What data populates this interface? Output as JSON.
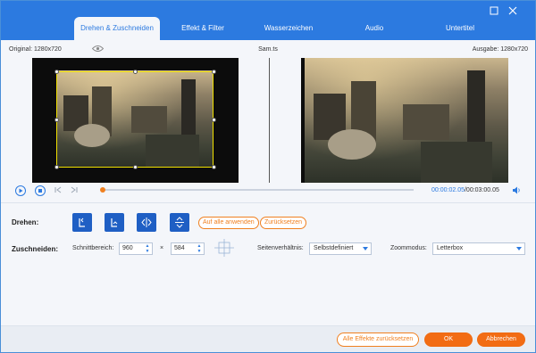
{
  "tabs": [
    {
      "label": "Drehen & Zuschneiden"
    },
    {
      "label": "Effekt & Filter"
    },
    {
      "label": "Wasserzeichen"
    },
    {
      "label": "Audio"
    },
    {
      "label": "Untertitel"
    }
  ],
  "window": {
    "restore_icon": "restore-icon",
    "close_icon": "close-icon"
  },
  "info": {
    "original": "Original: 1280x720",
    "filename": "Sam.ts",
    "output": "Ausgabe: 1280x720"
  },
  "playback": {
    "current_time": "00:00:02.05",
    "total_time": "/00:03:00.05",
    "progress": 0.005
  },
  "rotate": {
    "label": "Drehen:",
    "apply_all": "Auf alle anwenden",
    "reset": "Zurücksetzen"
  },
  "crop": {
    "label": "Zuschneiden:",
    "area_label": "Schnittbereich:",
    "width": "960",
    "times": "×",
    "height": "584",
    "aspect_label": "Seitenverhältnis:",
    "aspect_value": "Selbstdefiniert",
    "zoom_label": "Zoommodus:",
    "zoom_value": "Letterbox"
  },
  "footer": {
    "reset_all": "Alle Effekte zurücksetzen",
    "ok": "OK",
    "cancel": "Abbrechen"
  },
  "colors": {
    "accent": "#2c7ae0",
    "orange": "#f26c14",
    "crop_border": "#f0e000"
  }
}
